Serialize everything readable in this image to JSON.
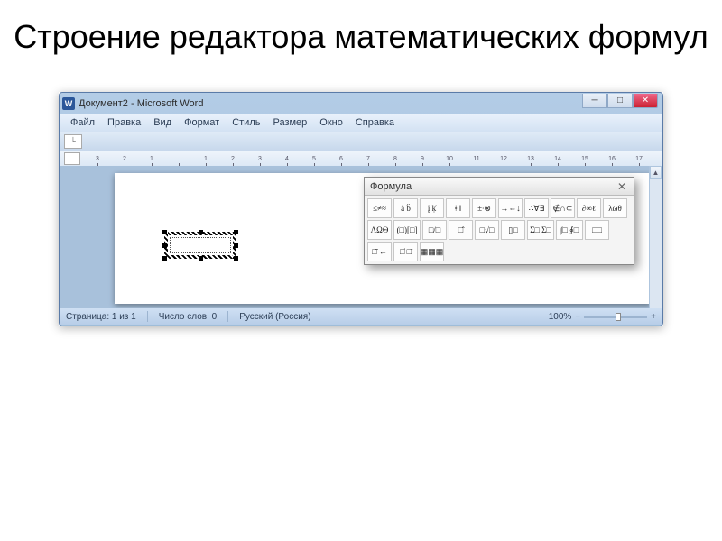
{
  "slide_title": "Строение редактора математических формул",
  "window": {
    "icon_letter": "W",
    "title": "Документ2 - Microsoft Word",
    "min": "─",
    "max": "□",
    "close": "✕"
  },
  "menu": [
    "Файл",
    "Правка",
    "Вид",
    "Формат",
    "Стиль",
    "Размер",
    "Окно",
    "Справка"
  ],
  "ruler_marks": [
    "3",
    "2",
    "1",
    "",
    "1",
    "2",
    "3",
    "4",
    "5",
    "6",
    "7",
    "8",
    "9",
    "10",
    "11",
    "12",
    "13",
    "14",
    "15",
    "16",
    "17"
  ],
  "palette": {
    "title": "Формула",
    "close": "✕",
    "row1": [
      "≤≠≈",
      "ȧ b̈",
      "į ḳ̇",
      "ǂ ǁ",
      "±∙⊗",
      "→⇔↓",
      "∴∀∃",
      "∉∩⊂",
      "∂∞ℓ",
      "λωθ",
      "ΛΩΘ"
    ],
    "row2": [
      "(□)[□]",
      "□/□",
      "□̂",
      "□√□",
      "▯□",
      "Σ□ Σ□",
      "∫□ ∮□",
      "□□",
      "□̄ ←",
      "□̇ □̈",
      "▦▦▦"
    ]
  },
  "status": {
    "page": "Страница: 1 из 1",
    "words": "Число слов: 0",
    "lang": "Русский (Россия)",
    "zoom": "100%",
    "minus": "−",
    "plus": "+"
  },
  "tab_corner": "└"
}
